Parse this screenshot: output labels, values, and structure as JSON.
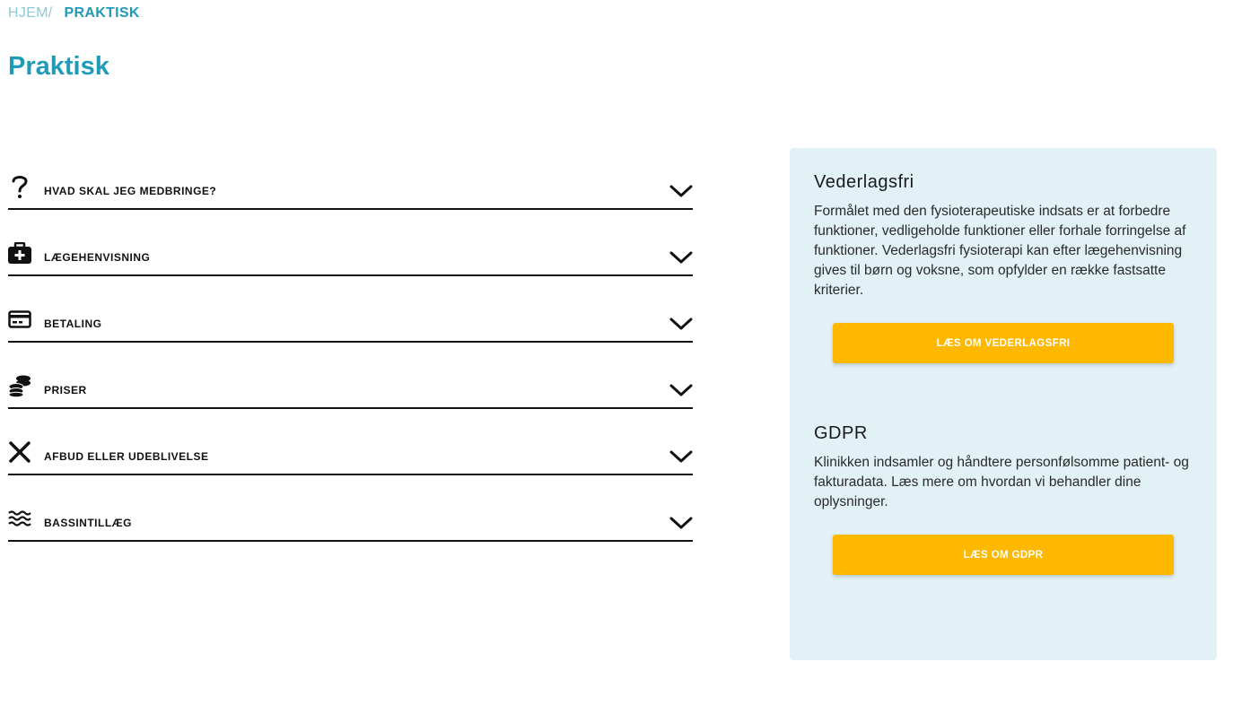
{
  "breadcrumb": {
    "home": "HJEM",
    "separator": "/",
    "current": "PRAKTISK"
  },
  "page_title": "Praktisk",
  "accordion": [
    {
      "label": "HVAD SKAL JEG MEDBRINGE?",
      "icon": "question-icon"
    },
    {
      "label": "LÆGEHENVISNING",
      "icon": "medical-kit-icon"
    },
    {
      "label": "BETALING",
      "icon": "credit-card-icon"
    },
    {
      "label": "PRISER",
      "icon": "coins-icon"
    },
    {
      "label": "AFBUD ELLER UDEBLIVELSE",
      "icon": "cross-icon"
    },
    {
      "label": "BASSINTILLÆG",
      "icon": "water-waves-icon"
    }
  ],
  "sidebar": {
    "vederlagsfri": {
      "title": "Vederlagsfri",
      "text": "Formålet med den fysioterapeutiske indsats er at forbedre funktioner, vedligeholde funktioner eller forhale forringelse af funktioner. Vederlagsfri fysioterapi kan efter lægehenvisning gives til børn og voksne, som opfylder en række fastsatte kriterier.",
      "button": "LÆS OM VEDERLAGSFRI"
    },
    "gdpr": {
      "title": "GDPR",
      "text": "Klinikken indsamler og håndtere personfølsomme patient- og fakturadata. Læs mere om hvordan vi behandler dine oplysninger.",
      "button": "LÆS OM GDPR"
    }
  },
  "colors": {
    "accent": "#1f9bb8",
    "breadcrumb_muted": "#8ec9d9",
    "button": "#ffb800",
    "panel_bg": "#e1f1f5"
  }
}
